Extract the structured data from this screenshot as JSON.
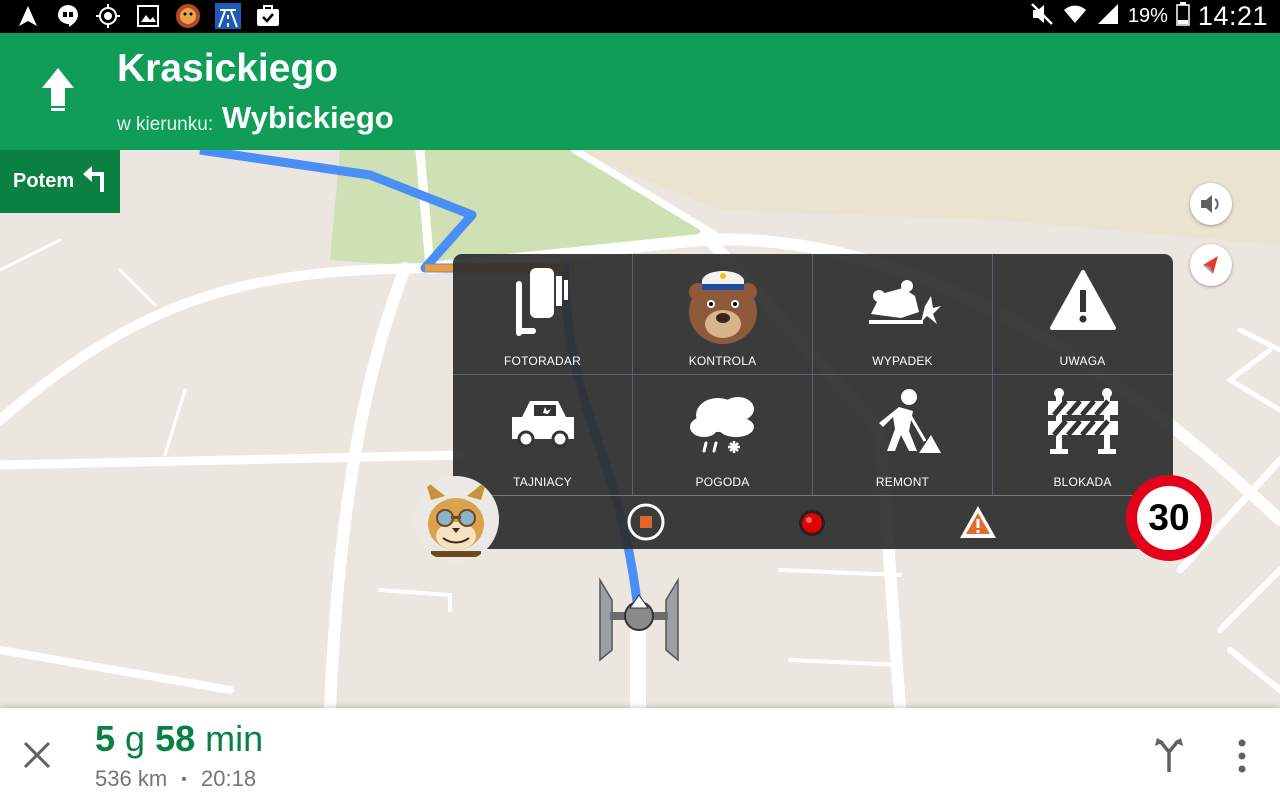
{
  "status_bar": {
    "icons": [
      "navigation-icon",
      "hangouts-icon",
      "gps-icon",
      "gallery-icon",
      "app-badge-icon",
      "highway-icon",
      "clipboard-check-icon"
    ],
    "battery": "19%",
    "time": "14:21"
  },
  "nav": {
    "street": "Krasickiego",
    "towards_label": "w kierunku:",
    "towards_street": "Wybickiego",
    "then_label": "Potem"
  },
  "panel": {
    "items": [
      {
        "label": "FOTORADAR",
        "icon": "speed-camera-icon"
      },
      {
        "label": "KONTROLA",
        "icon": "police-bear-icon"
      },
      {
        "label": "WYPADEK",
        "icon": "accident-icon"
      },
      {
        "label": "UWAGA",
        "icon": "warning-icon"
      },
      {
        "label": "TAJNIACY",
        "icon": "unmarked-car-icon"
      },
      {
        "label": "POGODA",
        "icon": "weather-icon"
      },
      {
        "label": "REMONT",
        "icon": "roadworks-icon"
      },
      {
        "label": "BLOKADA",
        "icon": "roadblock-icon"
      }
    ]
  },
  "speed_limit": "30",
  "trip": {
    "hours": "5",
    "hours_unit": "g",
    "minutes": "58",
    "minutes_unit": "min",
    "distance": "536 km",
    "separator": "•",
    "arrival": "20:18"
  },
  "colors": {
    "nav_green": "#0f9d58",
    "nav_dark_green": "#0b8043",
    "route_blue": "#4285f4",
    "panel_bg": "#2d2d2d",
    "speed_red": "#e4001b"
  }
}
